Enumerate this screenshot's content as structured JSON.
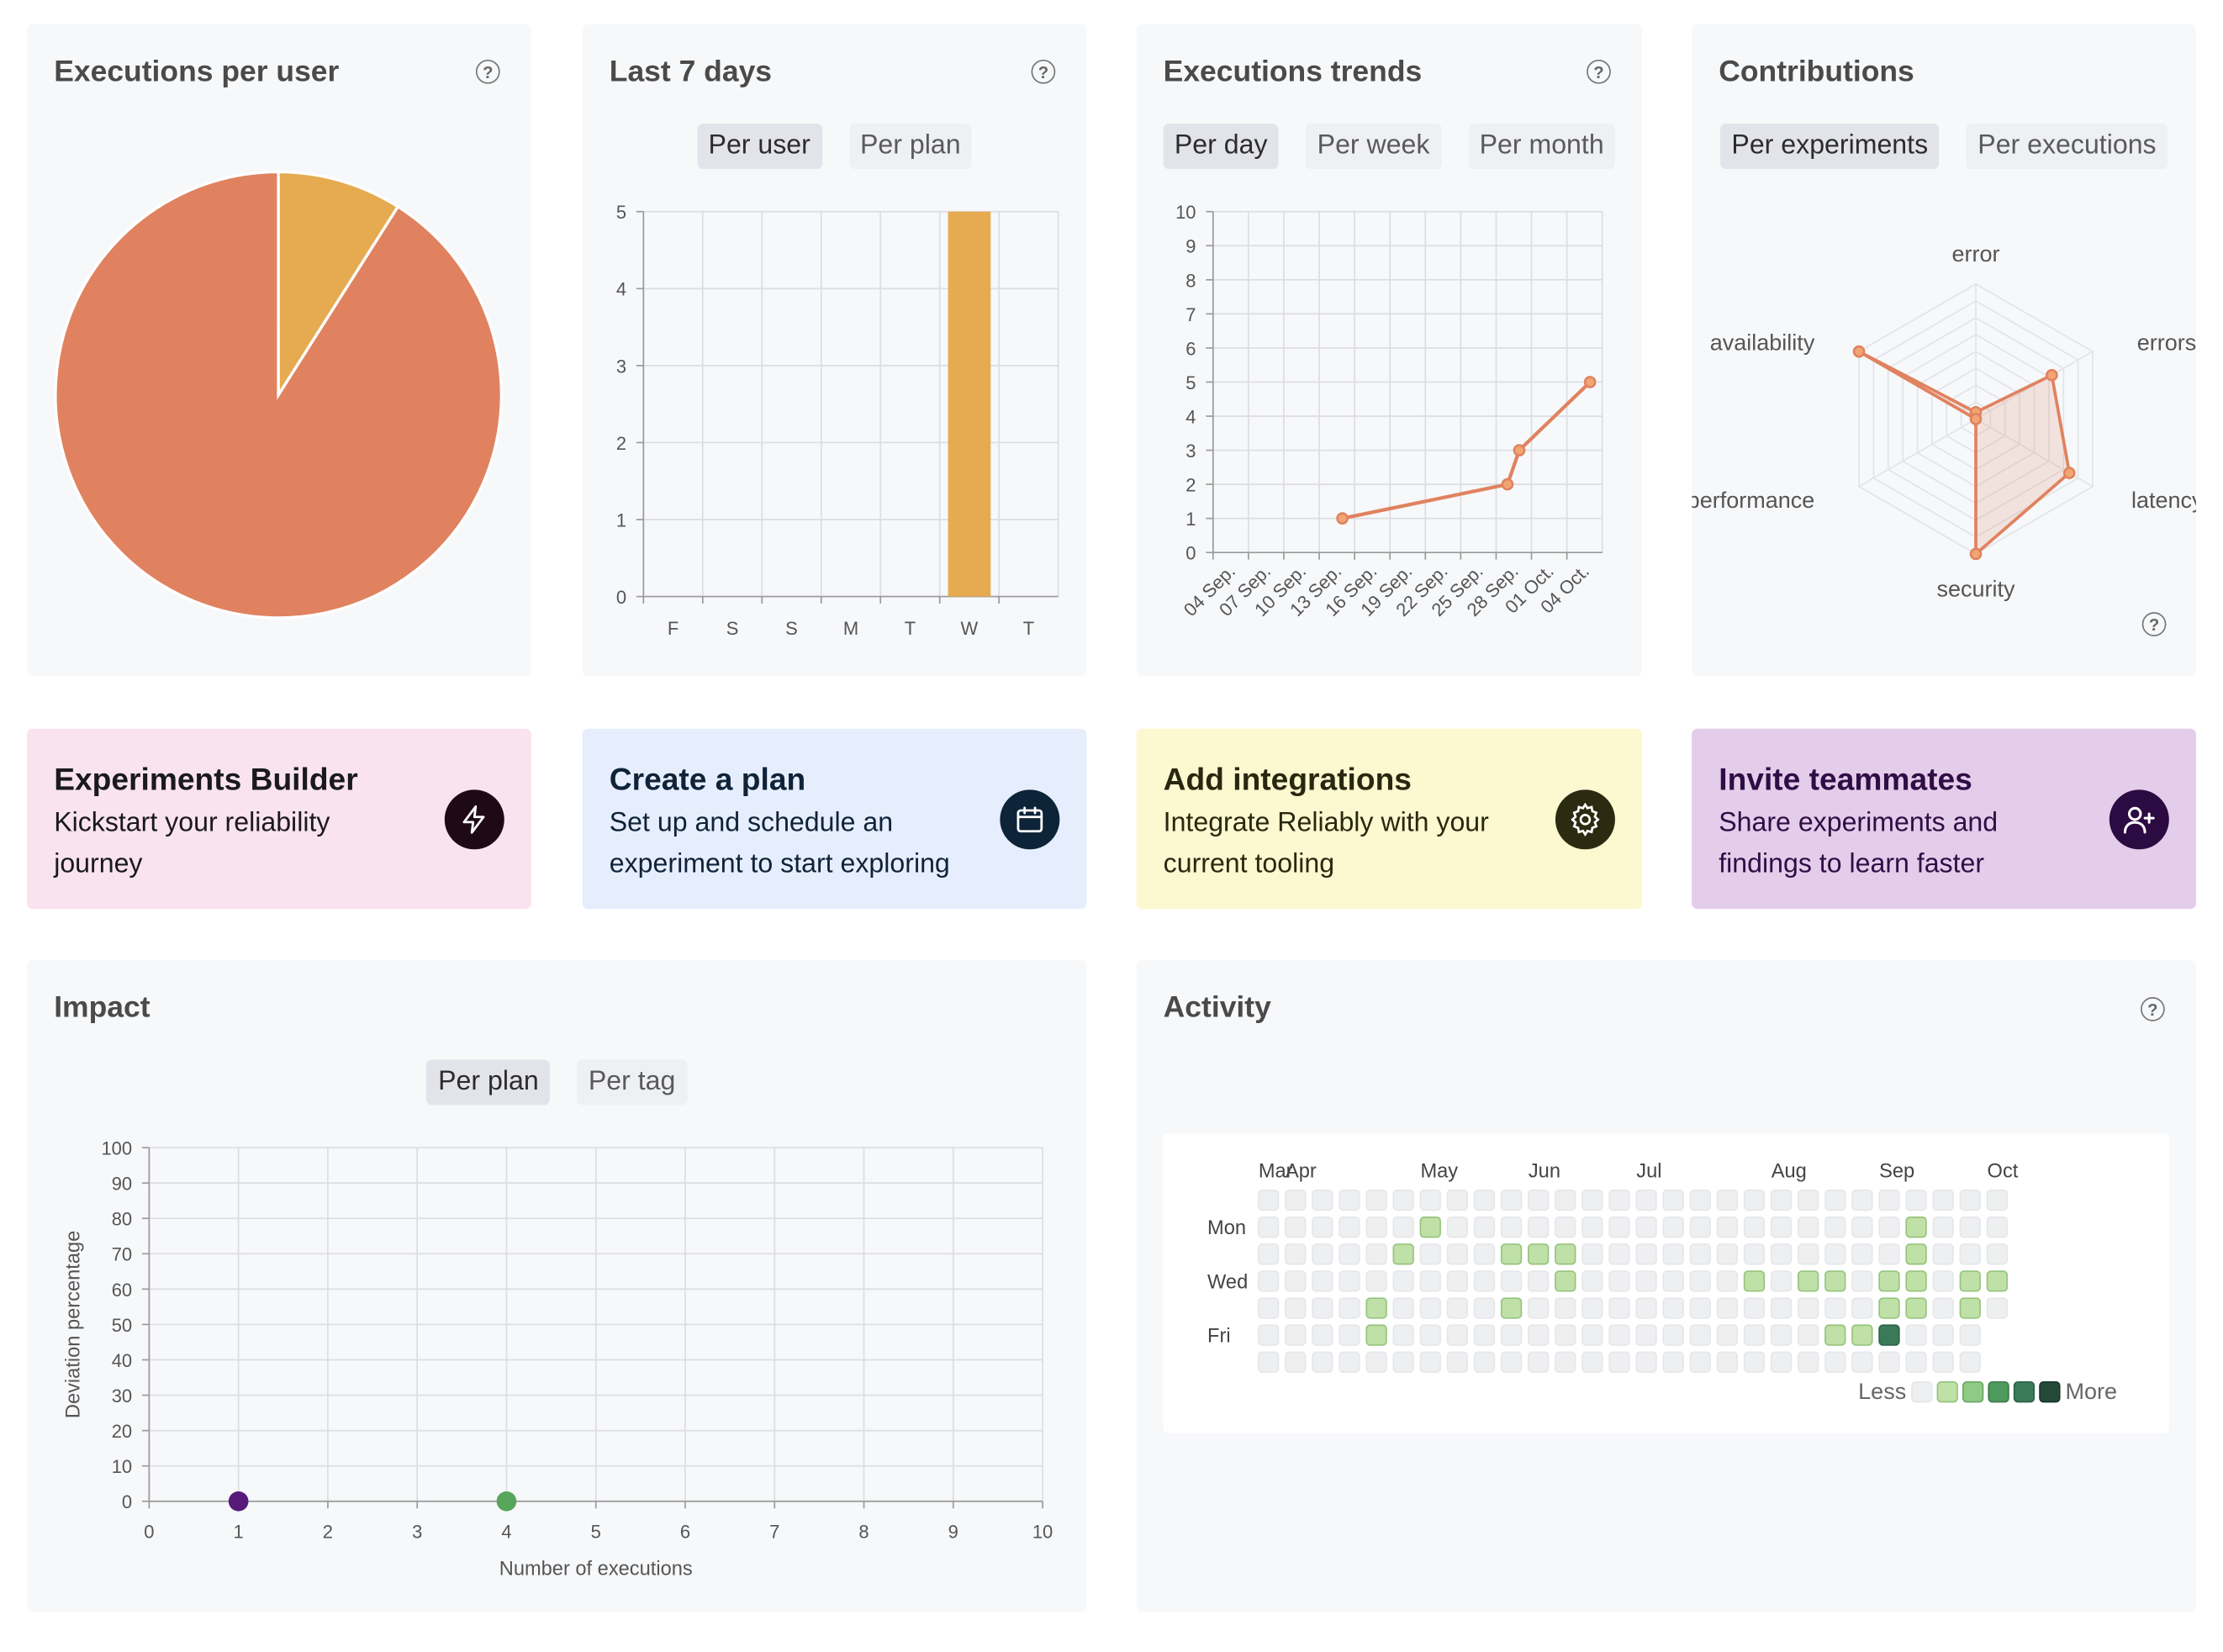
{
  "cards": {
    "executions_per_user": {
      "title": "Executions per user"
    },
    "last_7_days": {
      "title": "Last 7 days",
      "tabs": [
        "Per user",
        "Per plan"
      ],
      "active_tab": "Per user"
    },
    "executions_trends": {
      "title": "Executions trends",
      "tabs": [
        "Per day",
        "Per week",
        "Per month"
      ],
      "active_tab": "Per day"
    },
    "contributions": {
      "title": "Contributions",
      "tabs": [
        "Per experiments",
        "Per executions"
      ],
      "active_tab": "Per experiments"
    },
    "impact": {
      "title": "Impact",
      "tabs": [
        "Per plan",
        "Per tag"
      ],
      "active_tab": "Per plan"
    },
    "activity": {
      "title": "Activity"
    }
  },
  "ctas": [
    {
      "title": "Experiments Builder",
      "text": "Kickstart your reliability journey",
      "icon": "lightning-icon",
      "bg": "#f8e3ef",
      "circle": "#1e0a16",
      "title_color": "#1a1a1a",
      "text_color": "#1a1a1a"
    },
    {
      "title": "Create a plan",
      "text": "Set up and schedule an experiment to start exploring",
      "icon": "calendar-icon",
      "bg": "#e6eefd",
      "circle": "#0d2338",
      "title_color": "#0f2238",
      "text_color": "#0f2238"
    },
    {
      "title": "Add integrations",
      "text": "Integrate Reliably with your current tooling",
      "icon": "gear-icon",
      "bg": "#fcf8d0",
      "circle": "#2c2a10",
      "title_color": "#2a2710",
      "text_color": "#2a2710"
    },
    {
      "title": "Invite teammates",
      "text": "Share experiments and findings to learn faster",
      "icon": "add-user-icon",
      "bg": "#e3cdea",
      "circle": "#2c0a42",
      "title_color": "#300d45",
      "text_color": "#300d45"
    }
  ],
  "colors": {
    "orange": "#e0825f",
    "yellow": "#e6ab50",
    "purple": "#571a7a",
    "green": "#58a65c"
  },
  "chart_data": [
    {
      "type": "pie",
      "slices": [
        {
          "value": 91,
          "color": "#e0825f"
        },
        {
          "value": 9,
          "color": "#e6ab50"
        }
      ]
    },
    {
      "type": "bar",
      "categories": [
        "F",
        "S",
        "S",
        "M",
        "T",
        "W",
        "T"
      ],
      "values": [
        0,
        0,
        0,
        0,
        0,
        5,
        0
      ],
      "ylim": [
        0,
        5
      ],
      "yticks": [
        0,
        1,
        2,
        3,
        4,
        5
      ],
      "grid": true
    },
    {
      "type": "line",
      "x_ticks": [
        "04 Sep.",
        "07 Sep.",
        "10 Sep.",
        "13 Sep.",
        "16 Sep.",
        "19 Sep.",
        "22 Sep.",
        "25 Sep.",
        "28 Sep.",
        "01 Oct.",
        "04 Oct."
      ],
      "points": [
        {
          "x": "14 Sep.",
          "y": 1
        },
        {
          "x": "28 Sep.",
          "y": 2
        },
        {
          "x": "29 Sep.",
          "y": 3
        },
        {
          "x": "05 Oct.",
          "y": 5
        }
      ],
      "ylim": [
        0,
        10
      ],
      "yticks": [
        0,
        1,
        2,
        3,
        4,
        5,
        6,
        7,
        8,
        9,
        10
      ],
      "grid": true
    },
    {
      "type": "radar",
      "axes": [
        "error",
        "errors",
        "latency",
        "security",
        "performance",
        "availability"
      ],
      "values": [
        0.05,
        0.65,
        0.8,
        1.0,
        0.0,
        1.0
      ]
    },
    {
      "type": "scatter",
      "xlabel": "Number of executions",
      "ylabel": "Deviation percentage",
      "xlim": [
        0,
        10
      ],
      "ylim": [
        0,
        100
      ],
      "xticks": [
        0,
        1,
        2,
        3,
        4,
        5,
        6,
        7,
        8,
        9,
        10
      ],
      "yticks": [
        0,
        10,
        20,
        30,
        40,
        50,
        60,
        70,
        80,
        90,
        100
      ],
      "points": [
        {
          "x": 1,
          "y": 0,
          "color": "#571a7a"
        },
        {
          "x": 4,
          "y": 0,
          "color": "#58a65c"
        }
      ],
      "grid": true
    },
    {
      "type": "heatmap",
      "weeks": 28,
      "month_labels": [
        {
          "label": "Mar",
          "week": 0
        },
        {
          "label": "Apr",
          "week": 1
        },
        {
          "label": "May",
          "week": 6
        },
        {
          "label": "Jun",
          "week": 10
        },
        {
          "label": "Jul",
          "week": 14
        },
        {
          "label": "Aug",
          "week": 19
        },
        {
          "label": "Sep",
          "week": 23
        },
        {
          "label": "Oct",
          "week": 27
        }
      ],
      "day_labels": [
        {
          "label": "Mon",
          "row": 1
        },
        {
          "label": "Wed",
          "row": 3
        },
        {
          "label": "Fri",
          "row": 5
        }
      ],
      "active": [
        [
          6,
          1,
          1
        ],
        [
          5,
          2,
          1
        ],
        [
          9,
          2,
          1
        ],
        [
          10,
          2,
          1
        ],
        [
          11,
          2,
          1
        ],
        [
          24,
          2,
          1
        ],
        [
          11,
          3,
          1
        ],
        [
          18,
          3,
          1
        ],
        [
          20,
          3,
          1
        ],
        [
          21,
          3,
          1
        ],
        [
          23,
          3,
          1
        ],
        [
          24,
          3,
          1
        ],
        [
          26,
          3,
          1
        ],
        [
          27,
          3,
          1
        ],
        [
          4,
          4,
          1
        ],
        [
          9,
          4,
          1
        ],
        [
          23,
          4,
          1
        ],
        [
          24,
          4,
          1
        ],
        [
          26,
          4,
          1
        ],
        [
          4,
          5,
          1
        ],
        [
          21,
          5,
          1
        ],
        [
          22,
          5,
          1
        ],
        [
          23,
          5,
          4
        ],
        [
          24,
          1,
          1
        ]
      ],
      "missing_cells": [
        [
          27,
          5
        ],
        [
          27,
          6
        ]
      ],
      "legend_less": "Less",
      "legend_more": "More",
      "levels": [
        "#eeeff1",
        "#bfe0a6",
        "#8fcb84",
        "#4f9a5e",
        "#3a7a58",
        "#264a3a"
      ]
    }
  ]
}
